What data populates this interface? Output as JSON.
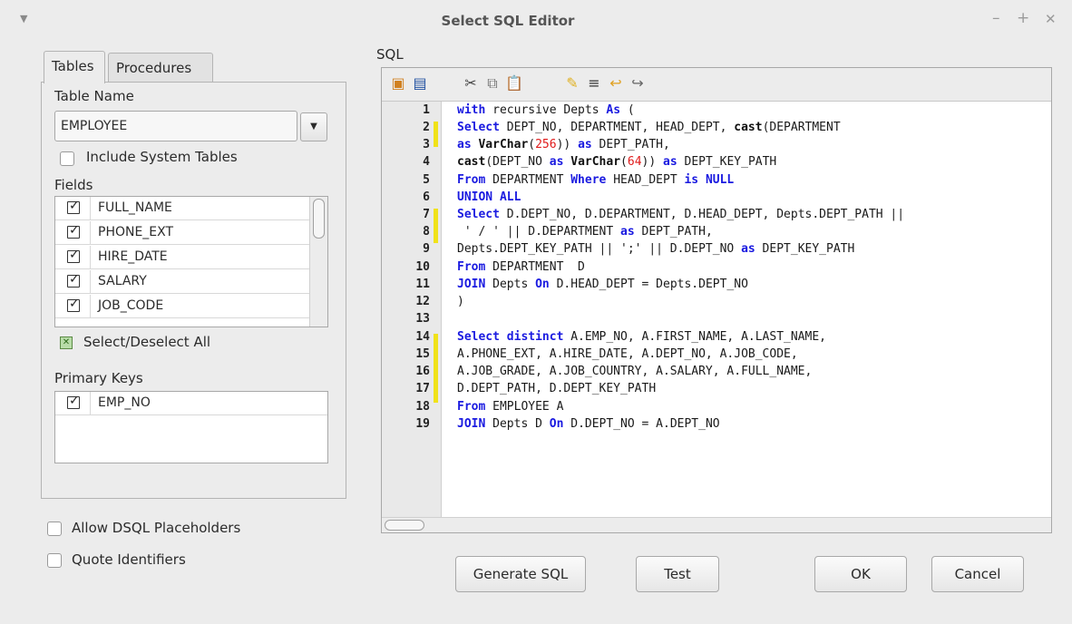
{
  "window": {
    "title": "Select SQL Editor",
    "controls": {
      "minimize": "–",
      "maximize": "+",
      "close": "✕"
    }
  },
  "left": {
    "tabs": [
      {
        "label": "Tables",
        "active": true
      },
      {
        "label": "Procedures",
        "active": false
      }
    ],
    "table_name_label": "Table Name",
    "table_name_value": "EMPLOYEE",
    "include_system_tables_label": "Include System Tables",
    "fields_label": "Fields",
    "fields": [
      {
        "name": "FULL_NAME",
        "checked": true
      },
      {
        "name": "PHONE_EXT",
        "checked": true
      },
      {
        "name": "HIRE_DATE",
        "checked": true
      },
      {
        "name": "SALARY",
        "checked": true
      },
      {
        "name": "JOB_CODE",
        "checked": true
      }
    ],
    "select_all_label": "Select/Deselect All",
    "primary_keys_label": "Primary Keys",
    "primary_keys": [
      {
        "name": "EMP_NO",
        "checked": true
      }
    ]
  },
  "options": {
    "allow_dsql_label": "Allow DSQL Placeholders",
    "quote_identifiers_label": "Quote Identifiers"
  },
  "sql": {
    "label": "SQL",
    "line_numbers": [
      "1",
      "2",
      "3",
      "4",
      "5",
      "6",
      "7",
      "8",
      "9",
      "10",
      "11",
      "12",
      "13",
      "14",
      "15",
      "16",
      "17",
      "18",
      "19"
    ]
  },
  "buttons": {
    "generate": "Generate SQL",
    "test": "Test",
    "ok": "OK",
    "cancel": "Cancel"
  }
}
